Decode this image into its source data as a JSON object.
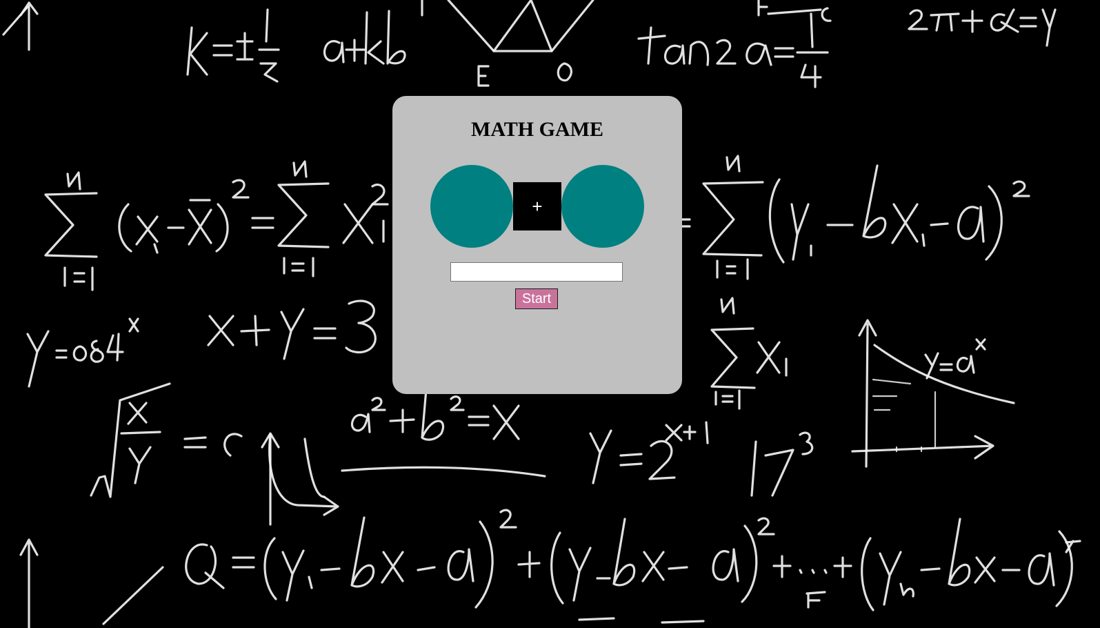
{
  "game": {
    "title": "MATH GAME",
    "operand_left": "",
    "operator": "+",
    "operand_right": "",
    "answer_value": "",
    "start_label": "Start"
  },
  "colors": {
    "background": "#000000",
    "panel": "#c0c0c0",
    "operand_circle": "#008080",
    "operator_box": "#000000",
    "start_button": "#c9739c"
  },
  "background_image": "chalkboard-math-formulas"
}
